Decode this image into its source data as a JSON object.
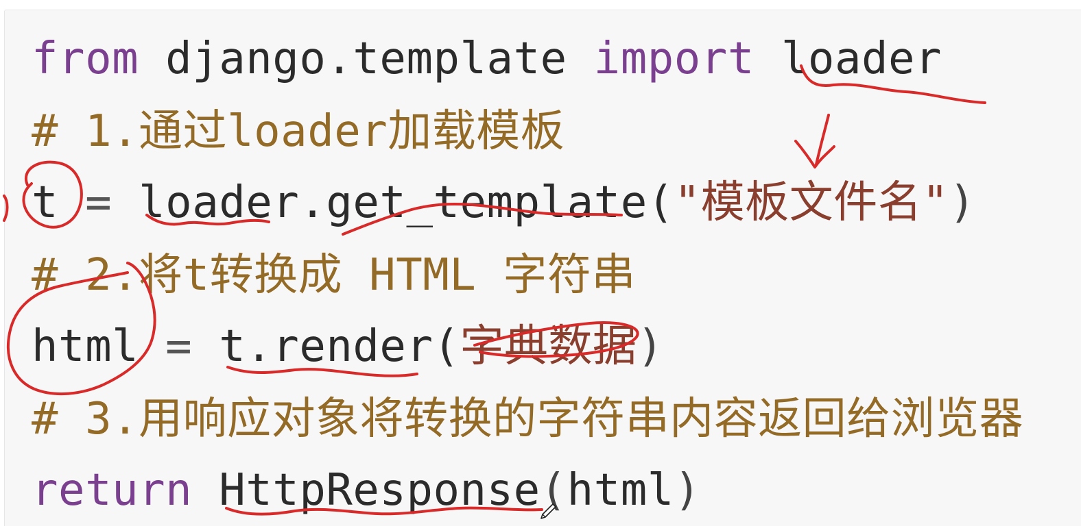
{
  "code": {
    "line1": {
      "kw1": "from",
      "mod": "django.template",
      "kw2": "import",
      "name": "loader"
    },
    "line2": {
      "comment": "# 1.通过loader加载模板"
    },
    "line3": {
      "var": "t",
      "eq": "=",
      "call": "loader.get_template(",
      "str": "\"模板文件名\"",
      "close": ")"
    },
    "line4": {
      "comment": "# 2.将t转换成 HTML 字符串"
    },
    "line5": {
      "var": "html",
      "eq": "=",
      "call": "t.render(",
      "arg": "字典数据",
      "close": ")"
    },
    "line6": {
      "comment": "# 3.用响应对象将转换的字符串内容返回给浏览器"
    },
    "line7": {
      "kw": "return",
      "call": "HttpResponse",
      "open": "(",
      "arg": "html",
      "close": ")"
    }
  },
  "colors": {
    "keyword": "#7a3f8e",
    "identifier": "#2b2b2b",
    "string": "#8a3e2d",
    "comment": "#946b26",
    "annotation": "#d92a2a",
    "panel_background": "#f7f7f8"
  },
  "annotations": {
    "pen_color": "red",
    "cursor_icon": "pen-cursor-icon"
  }
}
